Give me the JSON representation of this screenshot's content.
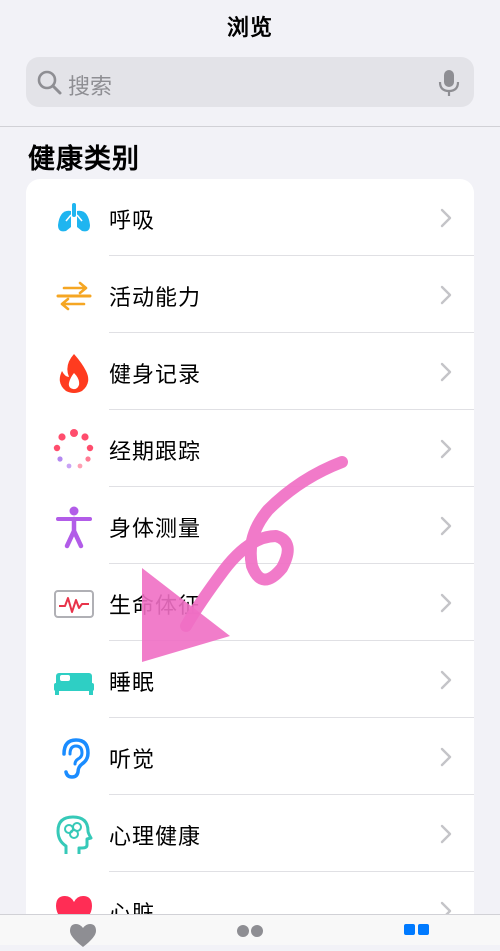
{
  "nav": {
    "title": "浏览"
  },
  "search": {
    "placeholder": "搜索",
    "search_icon": "magnifier-icon",
    "mic_icon": "microphone-icon"
  },
  "section": {
    "title": "健康类别"
  },
  "categories": [
    {
      "label": "呼吸",
      "icon": "lungs-icon",
      "color": "#1fb5f0"
    },
    {
      "label": "活动能力",
      "icon": "mobility-arrows-icon",
      "color": "#f5a623"
    },
    {
      "label": "健身记录",
      "icon": "flame-icon",
      "color": "#ff3b1f"
    },
    {
      "label": "经期跟踪",
      "icon": "cycle-dots-icon",
      "color": "#ff4d6d"
    },
    {
      "label": "身体测量",
      "icon": "person-icon",
      "color": "#b25ce8"
    },
    {
      "label": "生命体征",
      "icon": "vitals-monitor-icon",
      "color": "#e8334a"
    },
    {
      "label": "睡眠",
      "icon": "bed-icon",
      "color": "#2ecfc4"
    },
    {
      "label": "听觉",
      "icon": "ear-icon",
      "color": "#1a8cff"
    },
    {
      "label": "心理健康",
      "icon": "mind-head-icon",
      "color": "#36c9b8"
    },
    {
      "label": "心脏",
      "icon": "heart-icon",
      "color": "#ff2d55"
    }
  ],
  "tabbar": {
    "tabs": [
      "summary-heart-icon",
      "sharing-people-icon",
      "browse-grid-icon"
    ],
    "active_color": "#007aff"
  },
  "annotation": {
    "color": "#f06fc4"
  }
}
